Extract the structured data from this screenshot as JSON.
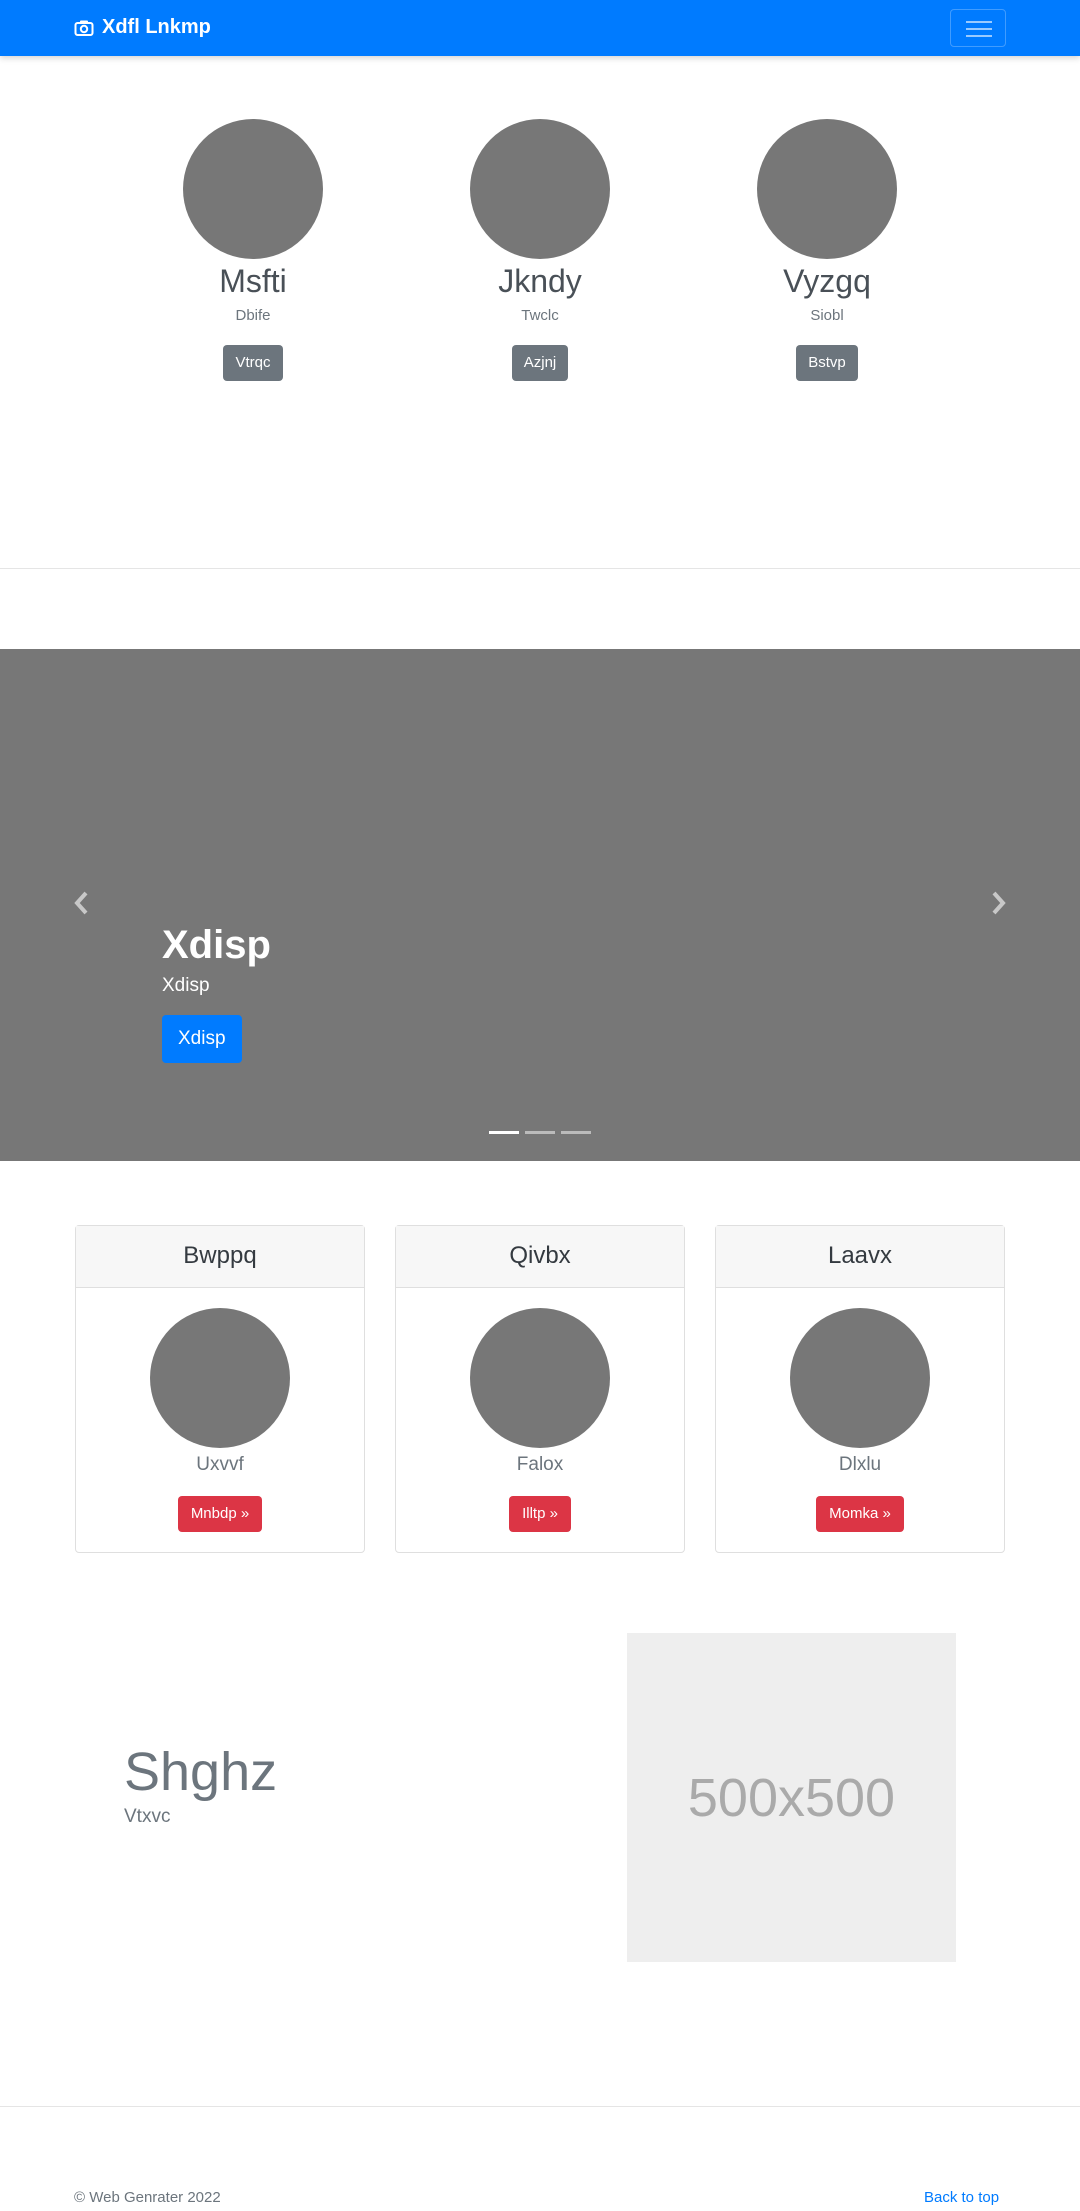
{
  "navbar": {
    "brand": "Xdfl Lnkmp",
    "brand_icon": "camera-icon",
    "toggler_icon": "hamburger-menu-icon"
  },
  "team": [
    {
      "name": "Msfti",
      "role": "Dbife",
      "button": "Vtrqc"
    },
    {
      "name": "Jkndy",
      "role": "Twclc",
      "button": "Azjnj"
    },
    {
      "name": "Vyzgq",
      "role": "Siobl",
      "button": "Bstvp"
    }
  ],
  "carousel": {
    "title": "Xdisp",
    "subtitle": "Xdisp",
    "button": "Xdisp",
    "slide_count": 3,
    "active_slide": 1
  },
  "cards": [
    {
      "header": "Bwppq",
      "text": "Uxvvf",
      "button": "Mnbdp »"
    },
    {
      "header": "Qivbx",
      "text": "Falox",
      "button": "Illtp »"
    },
    {
      "header": "Laavx",
      "text": "Dlxlu",
      "button": "Momka »"
    }
  ],
  "feature": {
    "heading": "Shghz",
    "text": "Vtxvc",
    "image_label": "500x500"
  },
  "footer": {
    "copyright": "© Web Genrater 2022",
    "back_to_top": "Back to top"
  },
  "colors": {
    "primary": "#007bff",
    "secondary": "#6c757d",
    "danger": "#dc3545",
    "placeholder_gray": "#777777"
  }
}
